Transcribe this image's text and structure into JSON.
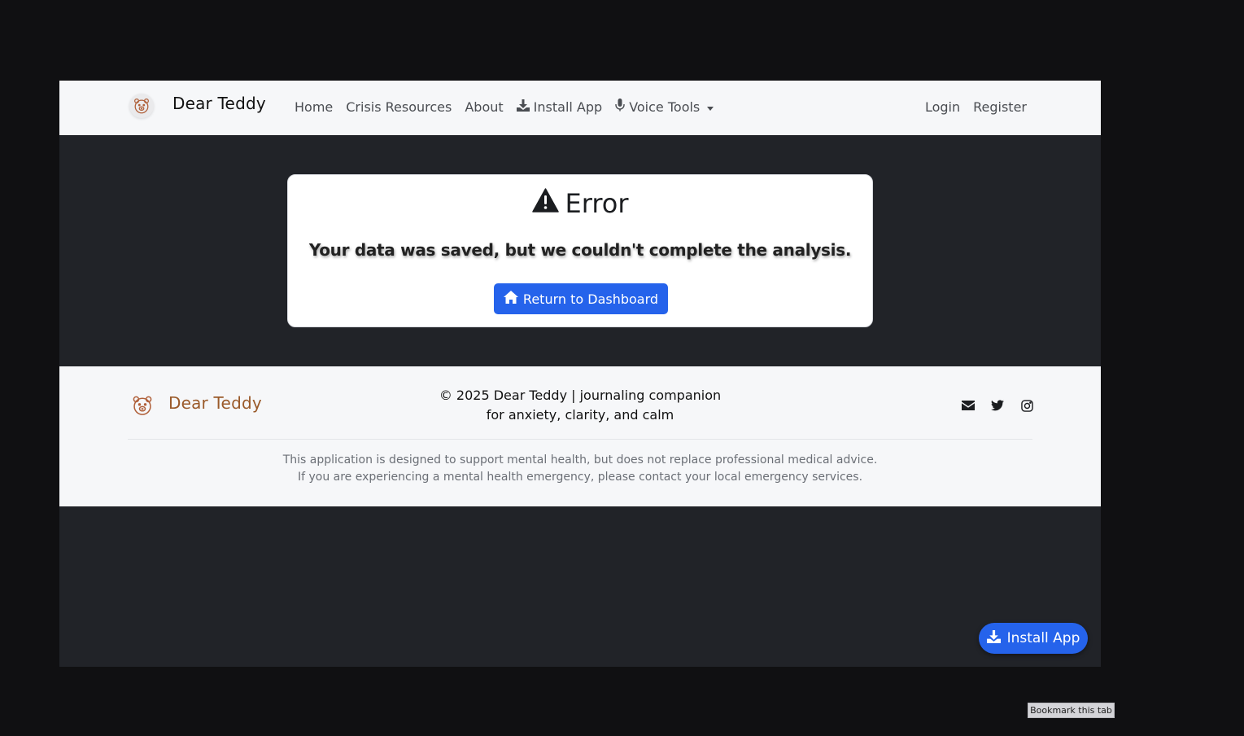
{
  "navbar": {
    "brand": "Dear Teddy",
    "brand_icon": "teddy-bear-icon",
    "links": {
      "home": "Home",
      "crisis": "Crisis Resources",
      "about": "About",
      "install": "Install App",
      "voice": "Voice Tools"
    },
    "login": "Login",
    "register": "Register"
  },
  "error_card": {
    "title": "Error",
    "title_icon": "warning-triangle-icon",
    "message": "Your data was saved, but we couldn't complete the analysis.",
    "button_label": "Return to Dashboard",
    "button_icon": "home-icon"
  },
  "footer": {
    "brand": "Dear Teddy",
    "copyright_line1": "© 2025 Dear Teddy | journaling companion",
    "copyright_line2": "for anxiety, clarity, and calm",
    "social": [
      "envelope-icon",
      "twitter-icon",
      "instagram-icon"
    ],
    "disclaimer_line1": "This application is designed to support mental health, but does not replace professional medical advice.",
    "disclaimer_line2": "If you are experiencing a mental health emergency, please contact your local emergency services."
  },
  "fab": {
    "label": "Install App",
    "icon": "download-icon"
  },
  "browser": {
    "bookmark_tooltip": "Bookmark this tab"
  },
  "colors": {
    "accent": "#2563eb",
    "brand_brown": "#9a5a2a",
    "page_bg": "#212328",
    "nav_bg": "#f6f7f9"
  }
}
